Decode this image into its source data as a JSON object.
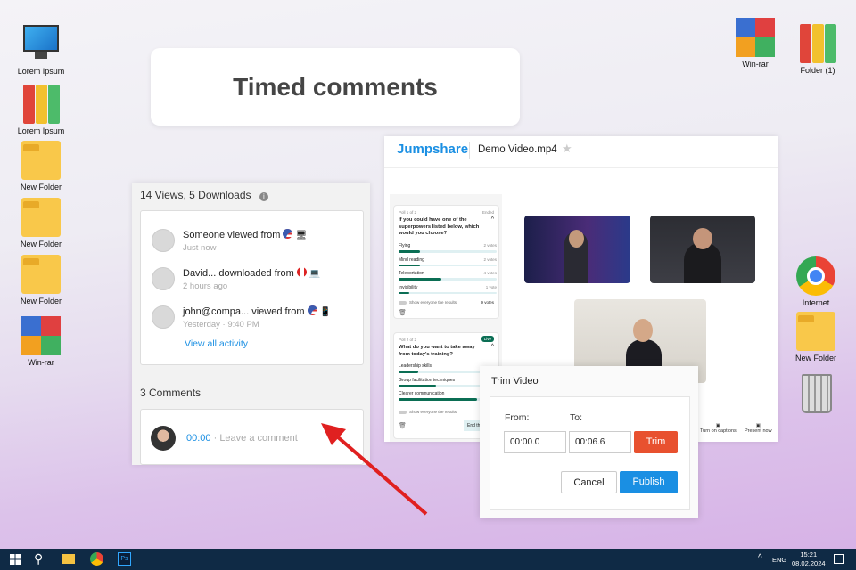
{
  "desktop": {
    "left_icons": [
      "Lorem Ipsum",
      "Lorem Ipsum",
      "New Folder",
      "New Folder",
      "New Folder",
      "Win-rar"
    ],
    "right_icons": [
      "Win-rar",
      "Folder (1)",
      "Internet",
      "New Folder"
    ]
  },
  "title_card": "Timed comments",
  "activity": {
    "header": "14 Views, 5 Downloads",
    "items": [
      {
        "text": "Someone viewed from",
        "time": "Just now",
        "flag": "us",
        "device": "desktop"
      },
      {
        "text": "David... downloaded from",
        "time": "2 hours ago",
        "flag": "ca",
        "device": "laptop"
      },
      {
        "text": "john@compa... viewed from",
        "time": "Yesterday · 9:40 PM",
        "flag": "us",
        "device": "phone"
      }
    ],
    "view_all": "View all activity",
    "comments_header": "3 Comments",
    "comment": {
      "timestamp": "00:00",
      "placeholder": "· Leave a comment"
    }
  },
  "jumpshare": {
    "logo": "Jumpshare",
    "file": "Demo Video.mp4",
    "poll1": {
      "label": "Poll 1 of 2",
      "status": "Ended",
      "question": "If you could have one of the superpowers listed below, which would you choose?",
      "options": [
        {
          "name": "Flying",
          "votes": "2 votes",
          "pct": 22
        },
        {
          "name": "Mind reading",
          "votes": "2 votes",
          "pct": 22
        },
        {
          "name": "Teleportation",
          "votes": "4 votes",
          "pct": 44
        },
        {
          "name": "Invisibility",
          "votes": "1 vote",
          "pct": 11
        }
      ],
      "toggle": "Show everyone the results",
      "total": "9 votes"
    },
    "poll2": {
      "label": "Poll 2 of 2",
      "status": "Live",
      "question": "What do you want to take away from today's training?",
      "options": [
        {
          "name": "Leadership skills",
          "pct": 20
        },
        {
          "name": "Group facilitation techniques",
          "pct": 38
        },
        {
          "name": "Clearer communication",
          "pct": 80
        }
      ],
      "toggle": "Show everyone the results",
      "end": "End the"
    },
    "captions": "Turn on captions",
    "present": "Present now"
  },
  "trim": {
    "title": "Trim Video",
    "from_label": "From:",
    "to_label": "To:",
    "from": "00:00.0",
    "to": "00:06.6",
    "trim": "Trim",
    "cancel": "Cancel",
    "publish": "Publish"
  },
  "taskbar": {
    "lang": "ENG",
    "time": "15:21",
    "date": "08.02.2024"
  },
  "colors": {
    "accent": "#1a8fe3",
    "trim": "#e8512f",
    "arrow": "#e02020",
    "poll": "#0b6e54"
  }
}
